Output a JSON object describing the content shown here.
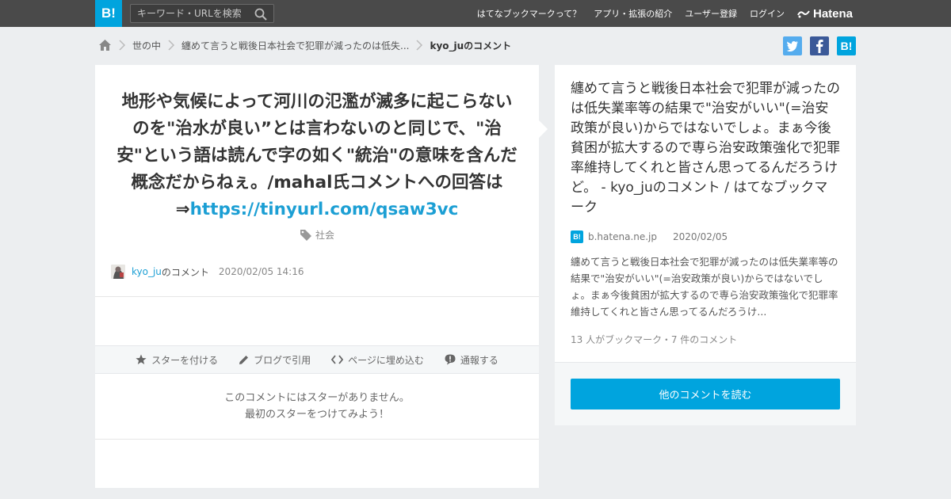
{
  "header": {
    "logo": "B!",
    "search_placeholder": "キーワード・URLを検索",
    "nav": [
      "はてなブックマークって？",
      "アプリ・拡張の紹介",
      "ユーザー登録",
      "ログイン"
    ],
    "brand": "Hatena"
  },
  "breadcrumb": {
    "items": [
      "世の中",
      "纏めて言うと戦後日本社会で犯罪が減ったのは低失..."
    ],
    "current": "kyo_juのコメント"
  },
  "share": {
    "twitter_color": "#55acee",
    "facebook_color": "#3b5998",
    "hatena_color": "#00a4de",
    "hatena_label": "B!"
  },
  "comment": {
    "text": "地形や気候によって河川の氾濫が滅多に起こらないのを\"治水が良い”とは言わないのと同じで、\"治安\"という語は読んで字の如く\"統治\"の意味を含んだ概念だからねぇ。/mahal氏コメントへの回答は⇒",
    "link": "https://tinyurl.com/qsaw3vc",
    "tag": "社会",
    "user": "kyo_ju",
    "user_suffix": "のコメント",
    "datetime": "2020/02/05 14:16"
  },
  "actions": {
    "star": "スターを付ける",
    "blog": "ブログで引用",
    "embed": "ページに埋め込む",
    "report": "通報する"
  },
  "nostar": {
    "line1": "このコメントにはスターがありません。",
    "line2": "最初のスターをつけてみよう！"
  },
  "entry": {
    "title": "纏めて言うと戦後日本社会で犯罪が減ったのは低失業率等の結果で\"治安がいい\"(=治安政策が良い)からではないでしょ。まぁ今後貧困が拡大するので専ら治安政策強化で犯罪率維持してくれと皆さん思ってるんだろうけど。 - kyo_juのコメント / はてなブックマーク",
    "domain": "b.hatena.ne.jp",
    "date": "2020/02/05",
    "description": "纏めて言うと戦後日本社会で犯罪が減ったのは低失業率等の結果で\"治安がいい\"(=治安政策が良い)からではないでしょ。まぁ今後貧困が拡大するので専ら治安政策強化で犯罪率維持してくれと皆さん思ってるんだろうけ...",
    "count": "13 人がブックマーク・7 件のコメント",
    "read_button": "他のコメントを読む"
  }
}
